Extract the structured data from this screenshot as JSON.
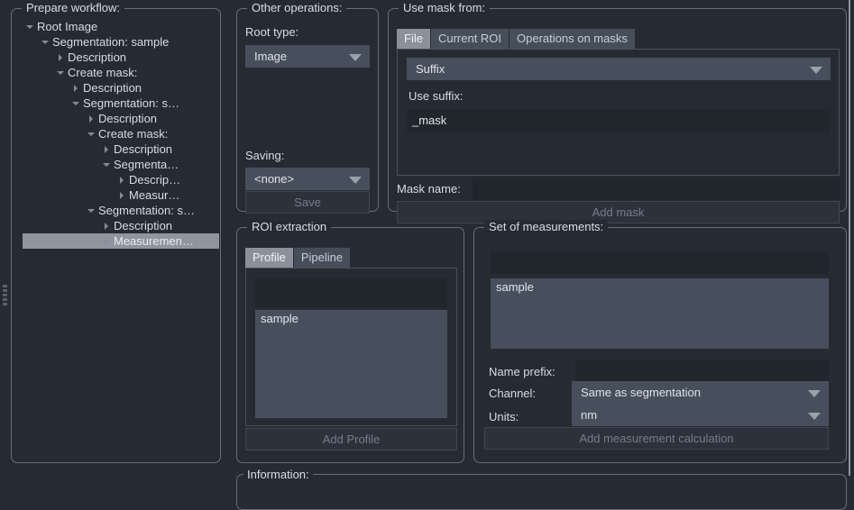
{
  "theme": {
    "background": "#262b33",
    "panel_border": "#666d78",
    "text": "#d6dae2",
    "disabled_text": "#767d88",
    "combo_bg": "#474f5c",
    "input_bg": "#21252c",
    "selection_bg": "#8f959f",
    "tab_active_bg": "#8b919b",
    "tab_inactive_bg": "#464e5a"
  },
  "tree_panel": {
    "legend": "Prepare workflow:",
    "splitter_icon": "drag-handle-icon",
    "items": [
      {
        "label": "Root Image",
        "indent": 0,
        "twisty": "down",
        "selected": false
      },
      {
        "label": "Segmentation: sample",
        "indent": 1,
        "twisty": "down",
        "selected": false
      },
      {
        "label": "Description",
        "indent": 2,
        "twisty": "right",
        "selected": false
      },
      {
        "label": "Create mask:",
        "indent": 2,
        "twisty": "down",
        "selected": false
      },
      {
        "label": "Description",
        "indent": 3,
        "twisty": "right",
        "selected": false
      },
      {
        "label": "Segmentation: s…",
        "indent": 3,
        "twisty": "down",
        "selected": false
      },
      {
        "label": "Description",
        "indent": 4,
        "twisty": "right",
        "selected": false
      },
      {
        "label": "Create mask:",
        "indent": 4,
        "twisty": "down",
        "selected": false
      },
      {
        "label": "Description",
        "indent": 5,
        "twisty": "right",
        "selected": false
      },
      {
        "label": "Segmenta…",
        "indent": 5,
        "twisty": "down",
        "selected": false
      },
      {
        "label": "Descrip…",
        "indent": 6,
        "twisty": "right",
        "selected": false
      },
      {
        "label": "Measur…",
        "indent": 6,
        "twisty": "right",
        "selected": false
      },
      {
        "label": "Segmentation: s…",
        "indent": 4,
        "twisty": "down",
        "selected": false
      },
      {
        "label": "Description",
        "indent": 5,
        "twisty": "right",
        "selected": false
      },
      {
        "label": "Measuremen…",
        "indent": 5,
        "twisty": "right",
        "selected": true
      }
    ]
  },
  "other_operations": {
    "legend": "Other operations:",
    "root_type_label": "Root type:",
    "root_type_value": "Image",
    "root_type_arrow": "chevron-down-icon",
    "saving_label": "Saving:",
    "saving_value": "<none>",
    "saving_arrow": "chevron-down-icon",
    "save_button": "Save",
    "save_button_enabled": false
  },
  "use_mask_from": {
    "legend": "Use mask from:",
    "tabs": [
      {
        "label": "File",
        "active": true
      },
      {
        "label": "Current ROI",
        "active": false
      },
      {
        "label": "Operations on masks",
        "active": false
      }
    ],
    "source_value": "Suffix",
    "source_arrow": "chevron-down-icon",
    "suffix_label": "Use suffix:",
    "suffix_value": "_mask",
    "mask_name_label": "Mask name:",
    "mask_name_value": "",
    "mask_name_placeholder": "",
    "add_mask_button": "Add mask",
    "add_mask_enabled": false
  },
  "roi_extraction": {
    "legend": "ROI extraction",
    "tabs": [
      {
        "label": "Profile",
        "active": true
      },
      {
        "label": "Pipeline",
        "active": false
      }
    ],
    "search_value": "",
    "search_placeholder": "",
    "list_items": [
      "sample"
    ],
    "add_button": "Add Profile",
    "add_button_enabled": false
  },
  "set_of_measurements": {
    "legend": "Set of measurements:",
    "search_value": "",
    "search_placeholder": "",
    "list_items": [
      "sample"
    ],
    "name_prefix_label": "Name prefix:",
    "name_prefix_value": "",
    "channel_label": "Channel:",
    "channel_value": "Same as segmentation",
    "channel_arrow": "chevron-down-icon",
    "units_label": "Units:",
    "units_value": "nm",
    "units_arrow": "chevron-down-icon",
    "add_button": "Add measurement calculation",
    "add_button_enabled": false
  },
  "information": {
    "legend": "Information:"
  }
}
